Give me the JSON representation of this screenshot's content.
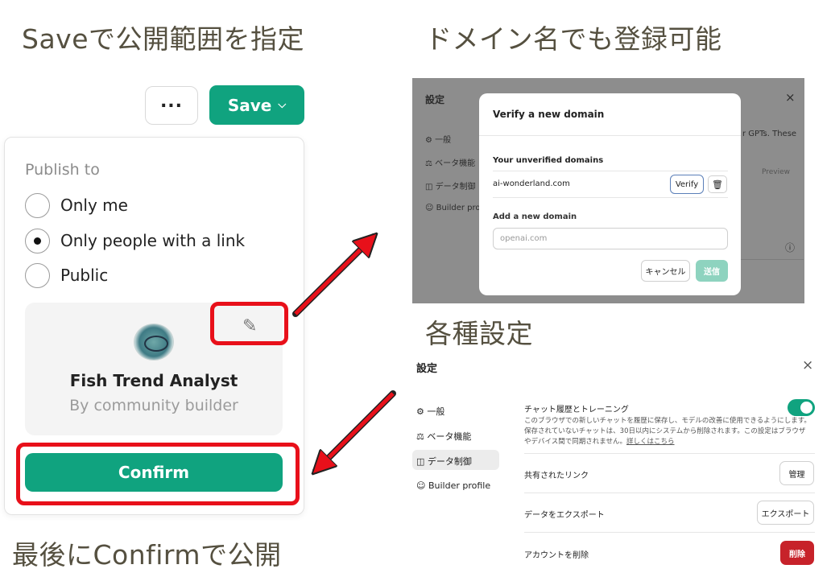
{
  "captions": {
    "save_scope": "Saveで公開範囲を指定",
    "domain_register": "ドメイン名でも登録可能",
    "settings": "各種設定",
    "confirm_publish": "最後にConfirmで公開"
  },
  "toolbar": {
    "more_label": "...",
    "save_label": "Save"
  },
  "publish": {
    "heading": "Publish to",
    "options": [
      "Only me",
      "Only people with a link",
      "Public"
    ],
    "selected": "Only people with a link",
    "gpt_name": "Fish Trend Analyst",
    "gpt_author": "By community builder",
    "confirm_label": "Confirm"
  },
  "domain_dialog": {
    "bg_title": "設定",
    "bg_close": "×",
    "bg_sidebar": [
      "一般",
      "ベータ機能",
      "データ制御",
      "Builder profi"
    ],
    "bg_right_text": "r GPTs. These",
    "bg_preview": "Preview",
    "title": "Verify a new domain",
    "unverified_label": "Your unverified domains",
    "domain": "ai-wonderland.com",
    "verify_label": "Verify",
    "add_label": "Add a new domain",
    "input_placeholder": "openai.com",
    "cancel_label": "キャンセル",
    "send_label": "送信"
  },
  "settings": {
    "title": "設定",
    "close": "×",
    "sidebar": [
      "一般",
      "ベータ機能",
      "データ制御",
      "Builder profile"
    ],
    "selected_sidebar": "データ制御",
    "history_title": "チャット履歴とトレーニング",
    "history_desc_1": "このブラウザでの新しいチャットを履歴に保存し、モデルの改善に使用できるようにします。",
    "history_desc_2": "保存されていないチャットは、30日以内にシステムから削除されます。この設定はブラウザ",
    "history_desc_3": "やデバイス間で同期されません。",
    "learn_more": "詳しくはこちら",
    "shared_links": "共有されたリンク",
    "manage_label": "管理",
    "export_data": "データをエクスポート",
    "export_label": "エクスポート",
    "delete_account": "アカウントを削除",
    "delete_label": "削除"
  }
}
